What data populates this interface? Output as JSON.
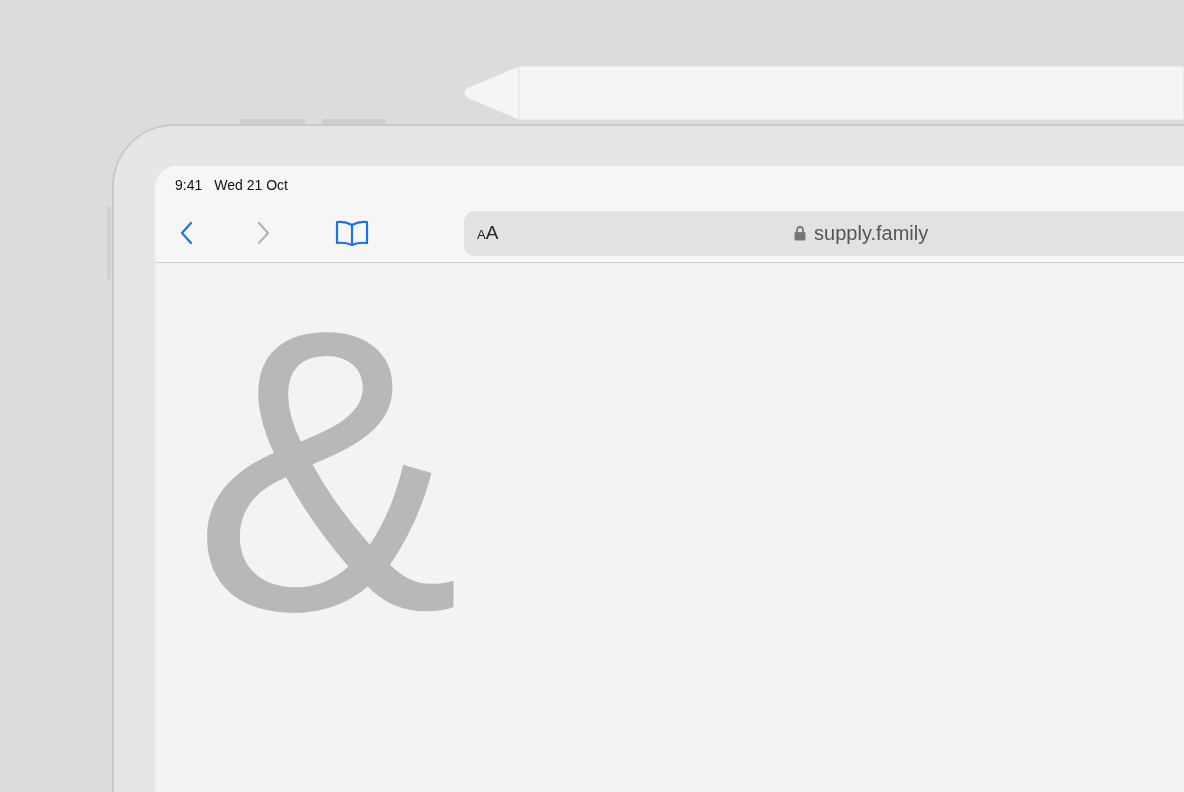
{
  "status_bar": {
    "time": "9:41",
    "date": "Wed 21 Oct"
  },
  "toolbar": {
    "back": {
      "disabled": false
    },
    "forward": {
      "disabled": true
    }
  },
  "address_bar": {
    "text_size_label": "AA",
    "secure": true,
    "url": "supply.family"
  },
  "page": {
    "glyph": "&"
  }
}
